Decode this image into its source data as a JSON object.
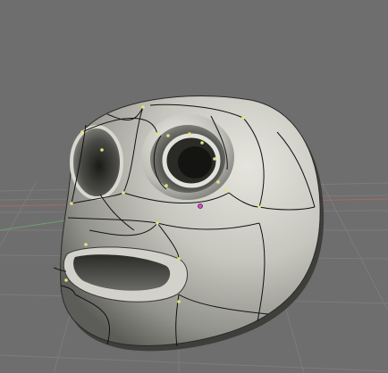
{
  "viewport": {
    "background_color": "#6e6e6e",
    "grid_color": "#7c7c7c",
    "x_axis_color": "#a86a6a",
    "y_axis_color": "#6f9f6f",
    "mesh_fill_color": "#c9c9c2",
    "mesh_shadow_color": "#4b4b48",
    "wire_color": "#111111",
    "vertex_color": "#e8e080",
    "pivot_color": "#d050c8"
  },
  "model": {
    "name": "head mesh",
    "shading": "smooth"
  }
}
